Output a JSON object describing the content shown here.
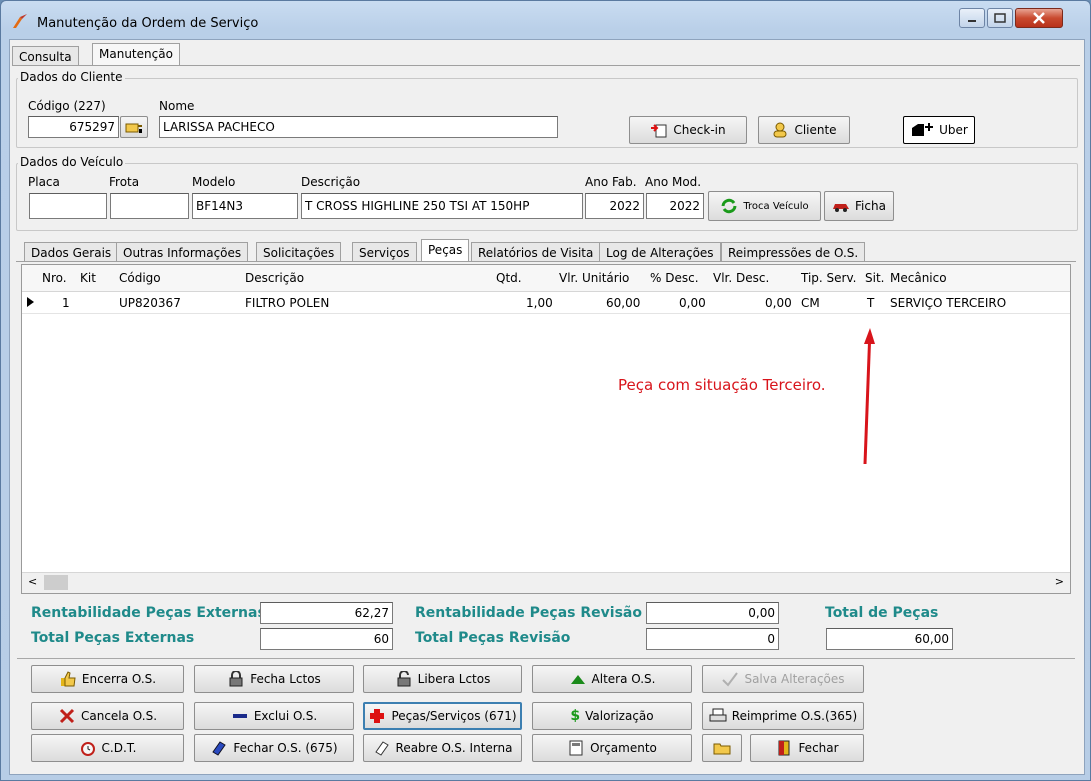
{
  "window": {
    "title": "Manutenção da Ordem de Serviço"
  },
  "top_tabs": [
    "Consulta",
    "Manutenção"
  ],
  "cliente": {
    "group_label": "Dados do Cliente",
    "codigo_label": "Código (227)",
    "codigo_value": "675297",
    "nome_label": "Nome",
    "nome_value": "LARISSA PACHECO",
    "checkin_label": "Check-in",
    "cliente_label": "Cliente",
    "uber_label": "Uber"
  },
  "veiculo": {
    "group_label": "Dados do Veículo",
    "placa_label": "Placa",
    "placa_value": "",
    "frota_label": "Frota",
    "frota_value": "",
    "modelo_label": "Modelo",
    "modelo_value": "BF14N3",
    "descricao_label": "Descrição",
    "descricao_value": "T CROSS HIGHLINE 250 TSI AT 150HP",
    "anofab_label": "Ano Fab.",
    "anofab_value": "2022",
    "anomod_label": "Ano Mod.",
    "anomod_value": "2022",
    "troca_label": "Troca Veículo",
    "ficha_label": "Ficha"
  },
  "inner_tabs": [
    "Dados Gerais",
    "Outras Informações",
    "Solicitações",
    "Serviços",
    "Peças",
    "Relatórios de Visita",
    "Log de Alterações",
    "Reimpressões de O.S."
  ],
  "grid": {
    "columns": [
      "Nro.",
      "Kit",
      "Código",
      "Descrição",
      "Qtd.",
      "Vlr. Unitário",
      "% Desc.",
      "Vlr. Desc.",
      "Tip. Serv.",
      "Sit.",
      "Mecânico"
    ],
    "rows": [
      {
        "nro": "1",
        "kit": "",
        "codigo": "UP820367",
        "descricao": "FILTRO POLEN",
        "qtd": "1,00",
        "vlr_unit": "60,00",
        "pct_desc": "0,00",
        "vlr_desc": "0,00",
        "tip_serv": "CM",
        "sit": "T",
        "mecanico": "SERVIÇO TERCEIRO"
      }
    ]
  },
  "annotation": "Peça com situação Terceiro.",
  "totals": {
    "rent_ext_label": "Rentabilidade Peças Externas",
    "rent_ext_value": "62,27",
    "total_ext_label": "Total Peças Externas",
    "total_ext_value": "60",
    "rent_rev_label": "Rentabilidade Peças Revisão",
    "rent_rev_value": "0,00",
    "total_rev_label": "Total Peças Revisão",
    "total_rev_value": "0",
    "total_pecas_label": "Total de Peças",
    "total_pecas_value": "60,00"
  },
  "actions": {
    "encerra": "Encerra O.S.",
    "fecha_lctos": "Fecha Lctos",
    "libera_lctos": "Libera Lctos",
    "altera": "Altera O.S.",
    "salva": "Salva Alterações",
    "cancela": "Cancela O.S.",
    "exclui": "Exclui O.S.",
    "pecas_servicos": "Peças/Serviços (671)",
    "valorizacao": "Valorização",
    "reimprime": "Reimprime O.S.(365)",
    "cdt": "C.D.T.",
    "fechar_os": "Fechar O.S. (675)",
    "reabre": "Reabre O.S. Interna",
    "orcamento": "Orçamento",
    "fechar": "Fechar"
  },
  "colors": {
    "accent_teal": "#1f8a8a",
    "annotation_red": "#d8141b"
  }
}
